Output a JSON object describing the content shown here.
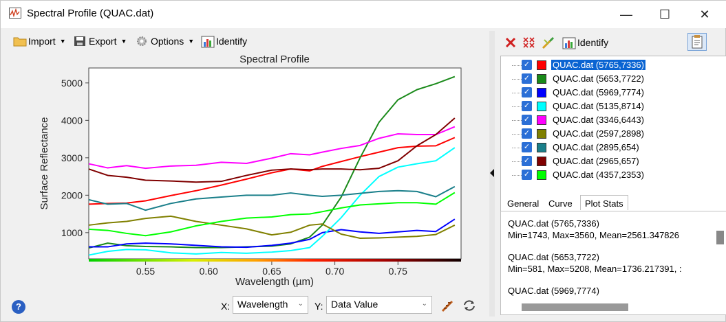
{
  "window": {
    "title": "Spectral Profile (QUAC.dat)",
    "minimize": "—",
    "maximize": "☐",
    "close": "✕"
  },
  "toolbar": {
    "import": "Import",
    "export": "Export",
    "options": "Options",
    "identify": "Identify"
  },
  "right_toolbar": {
    "identify": "Identify"
  },
  "bottom": {
    "x_label": "X:",
    "x_value": "Wavelength",
    "y_label": "Y:",
    "y_value": "Data Value"
  },
  "layers": [
    {
      "name": "QUAC.dat (5765,7336)",
      "color": "#ff0000",
      "selected": true
    },
    {
      "name": "QUAC.dat (5653,7722)",
      "color": "#1a8a1a",
      "selected": false
    },
    {
      "name": "QUAC.dat (5969,7774)",
      "color": "#0000ff",
      "selected": false
    },
    {
      "name": "QUAC.dat (5135,8714)",
      "color": "#00ffff",
      "selected": false
    },
    {
      "name": "QUAC.dat (3346,6443)",
      "color": "#ff00ff",
      "selected": false
    },
    {
      "name": "QUAC.dat (2597,2898)",
      "color": "#808000",
      "selected": false
    },
    {
      "name": "QUAC.dat (2895,654)",
      "color": "#1a7f8a",
      "selected": false
    },
    {
      "name": "QUAC.dat (2965,657)",
      "color": "#800000",
      "selected": false
    },
    {
      "name": "QUAC.dat (4357,2353)",
      "color": "#00ff00",
      "selected": false
    }
  ],
  "tabs": [
    "General",
    "Curve",
    "Plot Stats"
  ],
  "stats": [
    "QUAC.dat (5765,7336)",
    "  Min=1743, Max=3560, Mean=2561.347826",
    "QUAC.dat (5653,7722)",
    "  Min=581, Max=5208, Mean=1736.217391, :",
    "QUAC.dat (5969,7774)"
  ],
  "chart_data": {
    "type": "line",
    "title": "Spectral Profile",
    "xlabel": "Wavelength (µm)",
    "ylabel": "Surface Reflectance",
    "xlim": [
      0.505,
      0.8
    ],
    "ylim": [
      300,
      5400
    ],
    "xticks": [
      0.55,
      0.6,
      0.65,
      0.7,
      0.75
    ],
    "xtick_labels": [
      "0.55",
      "0.60",
      "0.65",
      "0.70",
      "0.75"
    ],
    "yticks": [
      1000,
      2000,
      3000,
      4000,
      5000
    ],
    "ytick_labels": [
      "1000",
      "2000",
      "3000",
      "4000",
      "5000"
    ],
    "x": [
      0.505,
      0.52,
      0.535,
      0.55,
      0.57,
      0.59,
      0.61,
      0.63,
      0.65,
      0.665,
      0.68,
      0.69,
      0.705,
      0.72,
      0.735,
      0.75,
      0.765,
      0.78,
      0.795
    ],
    "series": [
      {
        "name": "QUAC.dat (5765,7336)",
        "color": "#ff0000",
        "values": [
          1760,
          1780,
          1790,
          1850,
          1990,
          2120,
          2270,
          2430,
          2600,
          2700,
          2650,
          2770,
          2900,
          3030,
          3150,
          3270,
          3310,
          3320,
          3540
        ]
      },
      {
        "name": "QUAC.dat (5653,7722)",
        "color": "#1a8a1a",
        "values": [
          590,
          720,
          650,
          630,
          620,
          600,
          600,
          620,
          640,
          700,
          880,
          1200,
          1950,
          3000,
          3950,
          4550,
          4820,
          4980,
          5170
        ]
      },
      {
        "name": "QUAC.dat (5969,7774)",
        "color": "#0000ff",
        "values": [
          620,
          620,
          700,
          720,
          700,
          660,
          620,
          610,
          660,
          720,
          820,
          1000,
          1080,
          1020,
          980,
          1020,
          1060,
          1030,
          1360
        ]
      },
      {
        "name": "QUAC.dat (5135,8714)",
        "color": "#00ffff",
        "values": [
          400,
          500,
          550,
          540,
          460,
          430,
          470,
          450,
          480,
          520,
          600,
          900,
          1400,
          2000,
          2500,
          2750,
          2840,
          2920,
          3270
        ]
      },
      {
        "name": "QUAC.dat (3346,6443)",
        "color": "#ff00ff",
        "values": [
          2840,
          2730,
          2790,
          2720,
          2780,
          2800,
          2880,
          2850,
          2990,
          3110,
          3080,
          3150,
          3250,
          3330,
          3520,
          3640,
          3620,
          3620,
          3830
        ]
      },
      {
        "name": "QUAC.dat (2597,2898)",
        "color": "#808000",
        "values": [
          1200,
          1260,
          1300,
          1380,
          1440,
          1300,
          1200,
          1100,
          940,
          1010,
          1200,
          1230,
          960,
          850,
          860,
          880,
          900,
          950,
          1200
        ]
      },
      {
        "name": "QUAC.dat (2895,654)",
        "color": "#1a7f8a",
        "values": [
          1880,
          1760,
          1780,
          1600,
          1780,
          1900,
          1950,
          2000,
          2000,
          2060,
          2000,
          1970,
          2000,
          2050,
          2100,
          2120,
          2100,
          1960,
          2230
        ]
      },
      {
        "name": "QUAC.dat (2965,657)",
        "color": "#800000",
        "values": [
          2700,
          2530,
          2480,
          2400,
          2380,
          2350,
          2370,
          2530,
          2670,
          2700,
          2680,
          2700,
          2700,
          2680,
          2720,
          2920,
          3320,
          3620,
          4060
        ]
      },
      {
        "name": "QUAC.dat (4357,2353)",
        "color": "#00ff00",
        "values": [
          1090,
          1060,
          980,
          920,
          1020,
          1180,
          1300,
          1390,
          1420,
          1480,
          1500,
          1560,
          1660,
          1740,
          1770,
          1800,
          1800,
          1760,
          2070
        ]
      }
    ],
    "grid": false,
    "legend": "none"
  }
}
